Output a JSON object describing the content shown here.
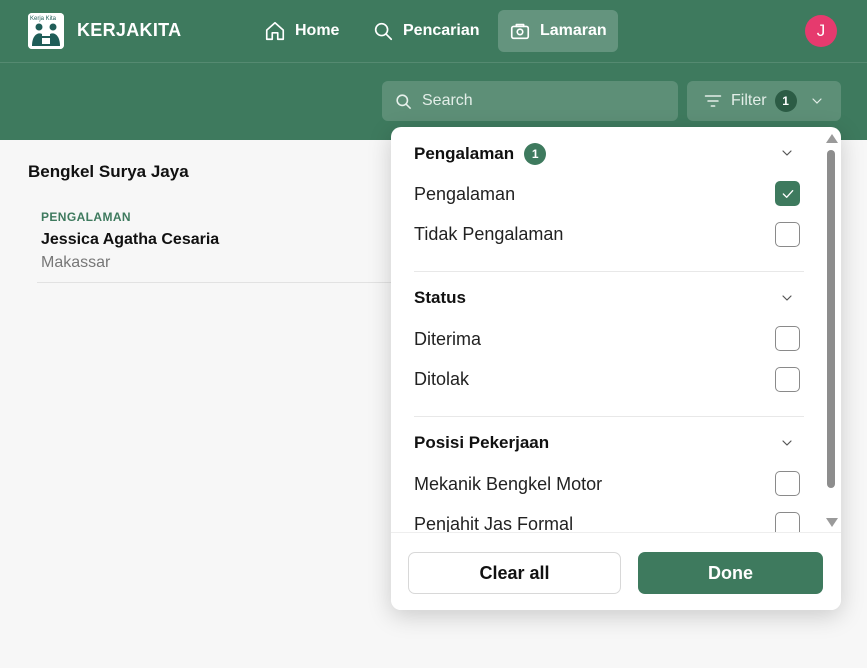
{
  "app": {
    "name": "KERJAKITA",
    "logo_caption": "Kerja Kita",
    "avatar_initial": "J"
  },
  "nav": {
    "items": [
      {
        "label": "Home",
        "icon": "home-icon"
      },
      {
        "label": "Pencarian",
        "icon": "search-icon"
      },
      {
        "label": "Lamaran",
        "icon": "briefcase-icon",
        "active": true
      }
    ]
  },
  "toolbar": {
    "search_placeholder": "Search",
    "filter_label": "Filter",
    "filter_count": "1"
  },
  "company": {
    "name": "Bengkel Surya Jaya"
  },
  "applicant": {
    "tag": "PENGALAMAN",
    "name": "Jessica Agatha Cesaria",
    "city": "Makassar"
  },
  "filter_panel": {
    "sections": [
      {
        "title": "Pengalaman",
        "badge": "1",
        "options": [
          {
            "label": "Pengalaman",
            "checked": true
          },
          {
            "label": "Tidak Pengalaman",
            "checked": false
          }
        ]
      },
      {
        "title": "Status",
        "badge": "",
        "options": [
          {
            "label": "Diterima",
            "checked": false
          },
          {
            "label": "Ditolak",
            "checked": false
          }
        ]
      },
      {
        "title": "Posisi Pekerjaan",
        "badge": "",
        "options": [
          {
            "label": "Mekanik Bengkel Motor",
            "checked": false
          },
          {
            "label": "Penjahit Jas Formal",
            "checked": false
          }
        ]
      }
    ],
    "clear_label": "Clear all",
    "done_label": "Done"
  },
  "colors": {
    "primary": "#3e7a5e",
    "avatar": "#e63a6e",
    "background": "#f7f7f7"
  }
}
